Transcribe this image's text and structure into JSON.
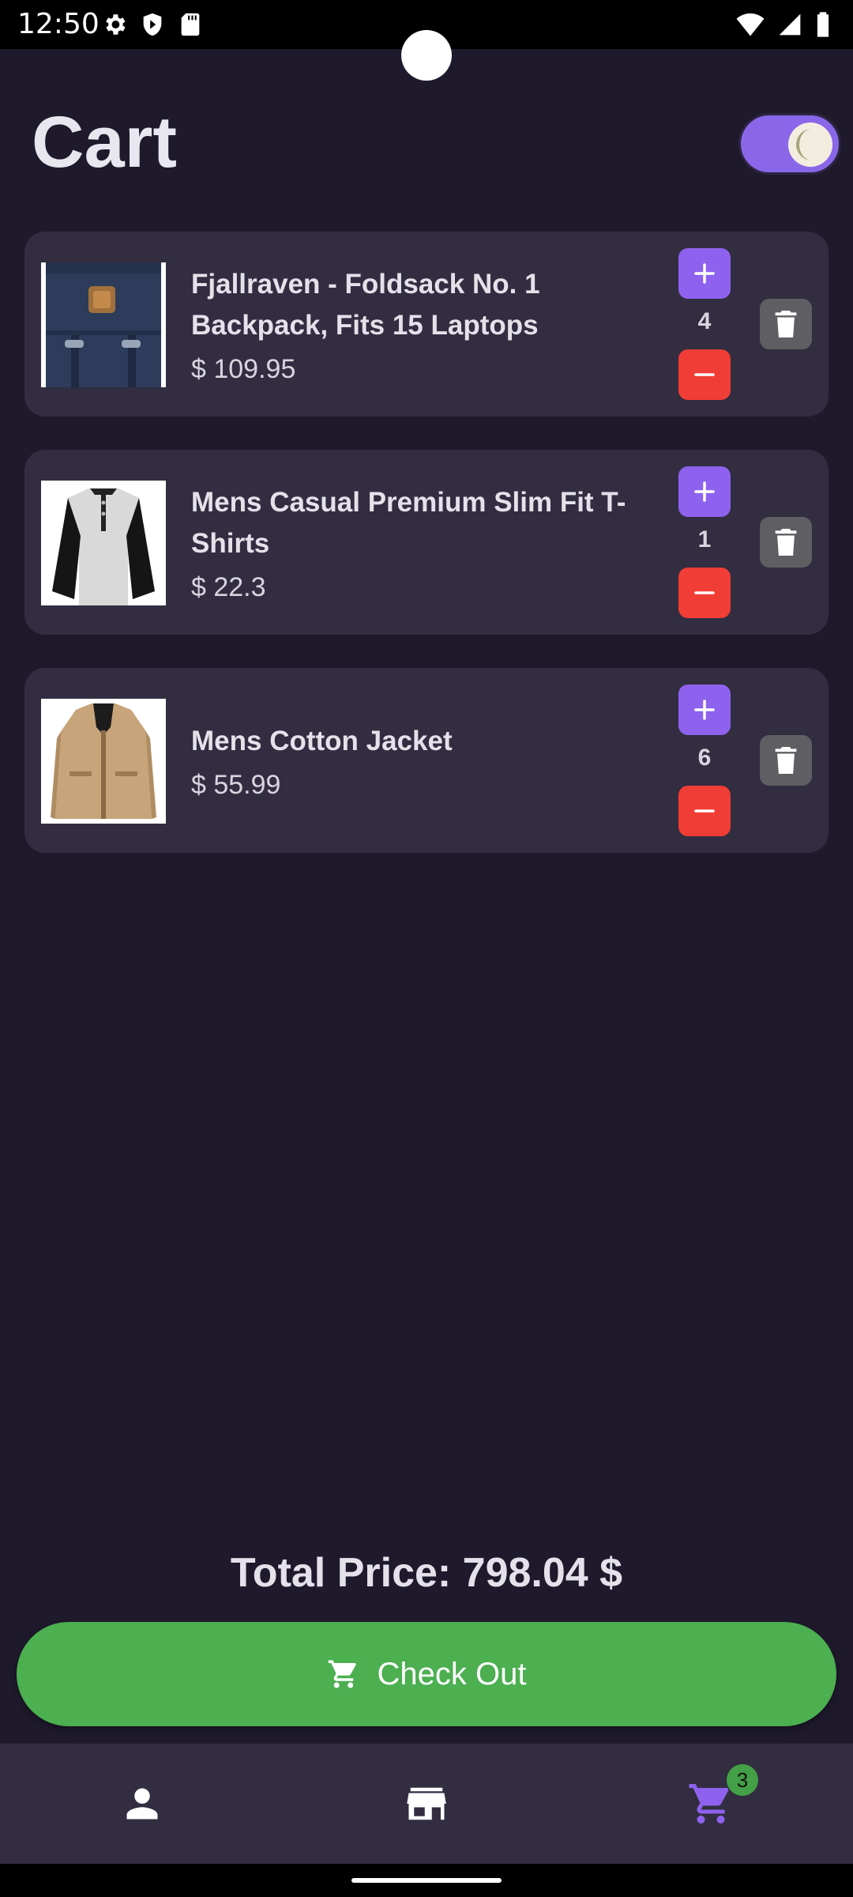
{
  "status_bar": {
    "time": "12:50"
  },
  "header": {
    "title": "Cart"
  },
  "cart": {
    "items": [
      {
        "name": "Fjallraven - Foldsack No. 1 Backpack, Fits 15 Laptops",
        "price": "$ 109.95",
        "quantity": "4"
      },
      {
        "name": "Mens Casual Premium Slim Fit T-Shirts",
        "price": "$ 22.3",
        "quantity": "1"
      },
      {
        "name": "Mens Cotton Jacket",
        "price": "$ 55.99",
        "quantity": "6"
      }
    ]
  },
  "summary": {
    "total_label": "Total Price: 798.04 $"
  },
  "checkout": {
    "label": "Check Out"
  },
  "bottom_nav": {
    "items": [
      {
        "icon": "person-icon",
        "active": false
      },
      {
        "icon": "store-icon",
        "active": false
      },
      {
        "icon": "cart-icon",
        "active": true,
        "badge": "3"
      }
    ]
  },
  "colors": {
    "background": "#1e1a2c",
    "card": "#322d40",
    "accent": "#8e62ee",
    "danger": "#f03d35",
    "success": "#4caf50"
  }
}
